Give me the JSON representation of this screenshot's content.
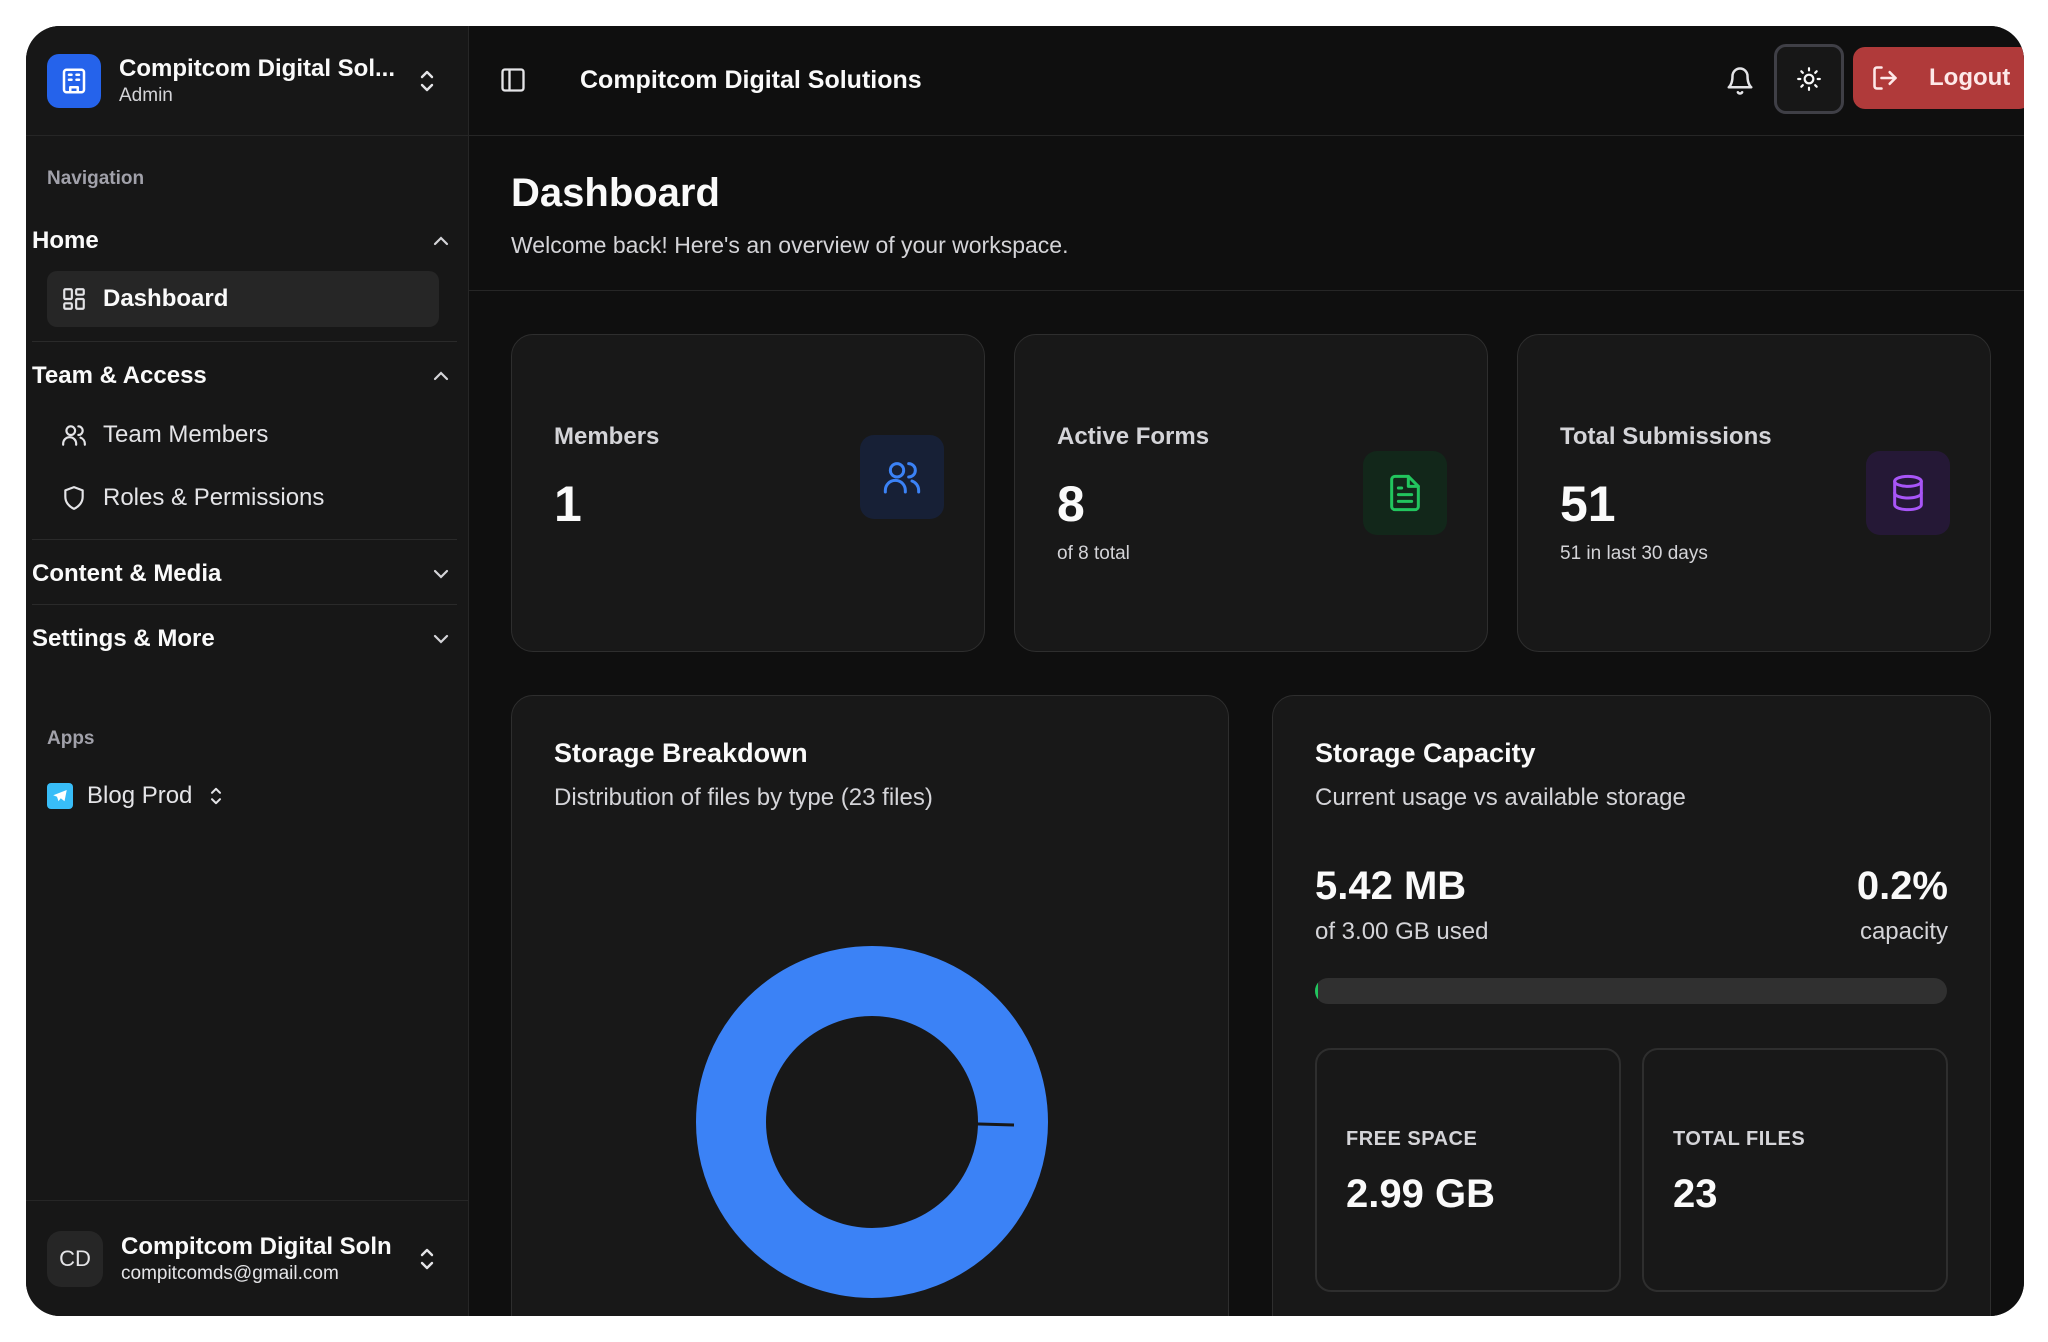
{
  "org": {
    "name": "Compitcom Digital Sol...",
    "role": "Admin"
  },
  "sidebar": {
    "nav_caption": "Navigation",
    "groups": [
      {
        "label": "Home",
        "expanded": true,
        "items": [
          {
            "label": "Dashboard",
            "icon": "layout-grid-icon",
            "active": true
          }
        ]
      },
      {
        "label": "Team & Access",
        "expanded": true,
        "items": [
          {
            "label": "Team Members",
            "icon": "users-icon"
          },
          {
            "label": "Roles & Permissions",
            "icon": "shield-icon"
          }
        ]
      },
      {
        "label": "Content & Media",
        "expanded": false,
        "items": []
      },
      {
        "label": "Settings & More",
        "expanded": false,
        "items": []
      }
    ],
    "apps_caption": "Apps",
    "app": {
      "label": "Blog Prod",
      "icon": "telegram-icon"
    }
  },
  "user": {
    "initials": "CD",
    "name": "Compitcom Digital Soln",
    "email": "compitcomds@gmail.com"
  },
  "topbar": {
    "title": "Compitcom Digital Solutions",
    "logout_label": "Logout"
  },
  "page": {
    "title": "Dashboard",
    "subtitle": "Welcome back! Here's an overview of your workspace."
  },
  "stats": [
    {
      "label": "Members",
      "value": "1",
      "sub": "",
      "icon": "users-icon",
      "color": "#3b82f6"
    },
    {
      "label": "Active Forms",
      "value": "8",
      "sub": "of 8 total",
      "icon": "file-text-icon",
      "color": "#22c55e"
    },
    {
      "label": "Total Submissions",
      "value": "51",
      "sub": "51 in last 30 days",
      "icon": "database-icon",
      "color": "#a855f7"
    }
  ],
  "storage_breakdown": {
    "title": "Storage Breakdown",
    "subtitle": "Distribution of files by type (23 files)",
    "color": "#3b82f6"
  },
  "storage_capacity": {
    "title": "Storage Capacity",
    "subtitle": "Current usage vs available storage",
    "used": "5.42 MB",
    "of_total": "of 3.00 GB used",
    "percent": "0.2%",
    "percent_caption": "capacity",
    "fill_fraction": 0.002,
    "free_label": "FREE SPACE",
    "free_value": "2.99 GB",
    "files_label": "TOTAL FILES",
    "files_value": "23"
  },
  "colors": {
    "accent": "#2563eb",
    "danger": "#b03a3a",
    "success": "#22c55e"
  }
}
